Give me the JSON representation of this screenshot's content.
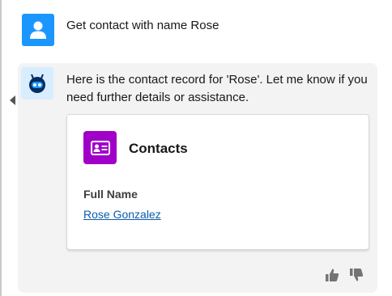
{
  "user_message": {
    "text": "Get contact with name Rose",
    "avatar_icon": "user-icon",
    "avatar_color": "#1b96ff"
  },
  "bot_message": {
    "text": "Here is the contact record for 'Rose'. Let me know if you need further details or assistance.",
    "avatar_icon": "bot-icon",
    "avatar_color": "#d8edff"
  },
  "record_card": {
    "object_label": "Contacts",
    "object_icon": "contact-card-icon",
    "icon_color": "#a100c9",
    "field_label": "Full Name",
    "field_value": "Rose Gonzalez",
    "link_color": "#0b5cab"
  },
  "feedback": {
    "thumbs_up_icon": "thumbs-up-icon",
    "thumbs_down_icon": "thumbs-down-icon"
  }
}
